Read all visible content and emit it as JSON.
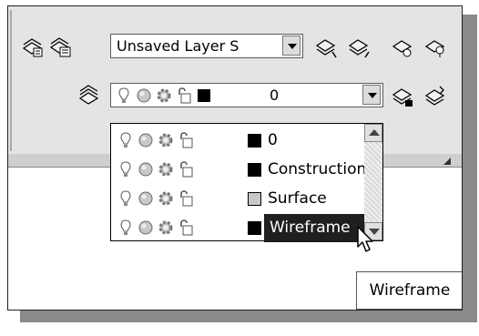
{
  "toolbar": {
    "layer_state_combo": {
      "value": "Unsaved Layer S"
    },
    "current_layer_combo": {
      "value": "0"
    }
  },
  "dropdown": {
    "items": [
      {
        "name": "0",
        "color": "#000000",
        "selected": false
      },
      {
        "name": "Construction",
        "color": "#000000",
        "selected": false
      },
      {
        "name": "Surface",
        "color": "#c8c8c8",
        "selected": false
      },
      {
        "name": "Wireframe",
        "color": "#000000",
        "selected": true
      }
    ]
  },
  "tooltip": {
    "text": "Wireframe"
  },
  "icons": {
    "state_icons": [
      "lightbulb-icon",
      "sun-freeze-icon",
      "gear-icon",
      "padlock-icon"
    ],
    "toolbar_icons": [
      "layer-properties-icon",
      "layer-states-icon",
      "layer-previous-icon",
      "layer-next-icon",
      "layer-isolate-icon",
      "layer-unisolate-icon",
      "layer-walk-icon",
      "layer-match-icon",
      "layer-freeze-icon"
    ]
  },
  "colors": {
    "ribbon_bg": "#e4e4e4",
    "selection_bg": "#1f1f1f",
    "window_border": "#222222"
  }
}
